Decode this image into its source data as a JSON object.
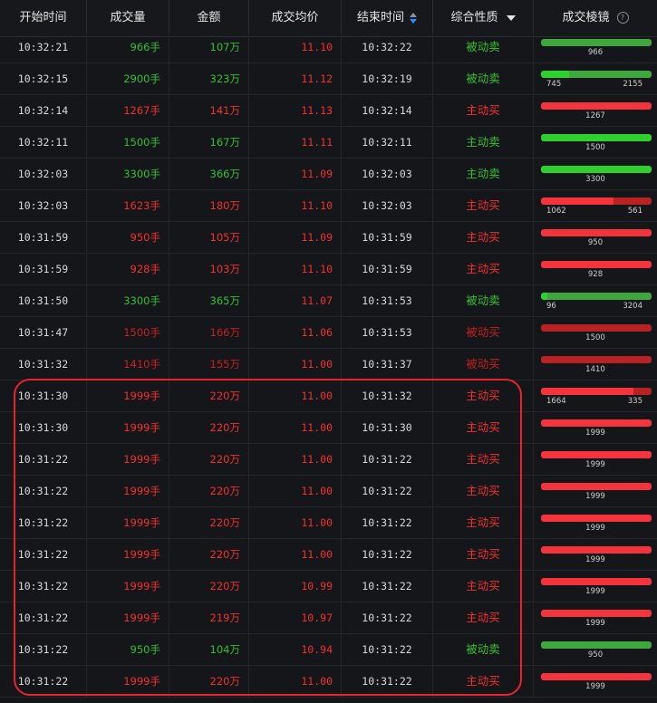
{
  "colors": {
    "buy": "#f23030",
    "sell": "#35c035",
    "dim_buy": "#c42020",
    "bar_buy": "#f5333c",
    "bar_sell": "#3ec83e",
    "highlight": "#e8232f"
  },
  "headers": {
    "start_time": "开始时间",
    "volume": "成交量",
    "amount": "金额",
    "avg_price": "成交均价",
    "end_time": "结束时间",
    "nature": "综合性质",
    "lens": "成交棱镜"
  },
  "icons": {
    "sort": "sort-icon",
    "filter": "filter-caret-icon",
    "help": "question-circle-icon"
  },
  "rows": [
    {
      "start": "10:32:21",
      "vol": "966手",
      "amt": "107万",
      "price": "11.10",
      "end": "10:32:22",
      "nature": "被动卖",
      "vcol": "g",
      "ncol": "g",
      "pcol": "r",
      "bar": [
        {
          "c": "sell",
          "v": 966,
          "label": "966"
        }
      ]
    },
    {
      "start": "10:32:15",
      "vol": "2900手",
      "amt": "323万",
      "price": "11.12",
      "end": "10:32:19",
      "nature": "被动卖",
      "vcol": "g",
      "ncol": "g",
      "pcol": "r",
      "bar": [
        {
          "c": "sell_bright",
          "v": 745,
          "label": "745"
        },
        {
          "c": "sell",
          "v": 2155,
          "label": "2155"
        }
      ]
    },
    {
      "start": "10:32:14",
      "vol": "1267手",
      "amt": "141万",
      "price": "11.13",
      "end": "10:32:14",
      "nature": "主动买",
      "vcol": "r",
      "ncol": "r",
      "pcol": "r",
      "bar": [
        {
          "c": "buy",
          "v": 1267,
          "label": "1267"
        }
      ]
    },
    {
      "start": "10:32:11",
      "vol": "1500手",
      "amt": "167万",
      "price": "11.11",
      "end": "10:32:11",
      "nature": "主动卖",
      "vcol": "g",
      "ncol": "g",
      "pcol": "r",
      "bar": [
        {
          "c": "sell_bright",
          "v": 1500,
          "label": "1500"
        }
      ]
    },
    {
      "start": "10:32:03",
      "vol": "3300手",
      "amt": "366万",
      "price": "11.09",
      "end": "10:32:03",
      "nature": "主动卖",
      "vcol": "g",
      "ncol": "g",
      "pcol": "r",
      "bar": [
        {
          "c": "sell_bright",
          "v": 3300,
          "label": "3300"
        }
      ]
    },
    {
      "start": "10:32:03",
      "vol": "1623手",
      "amt": "180万",
      "price": "11.10",
      "end": "10:32:03",
      "nature": "主动买",
      "vcol": "r",
      "ncol": "r",
      "pcol": "r",
      "bar": [
        {
          "c": "buy",
          "v": 1062,
          "label": "1062"
        },
        {
          "c": "buy_dim",
          "v": 561,
          "label": "561"
        }
      ]
    },
    {
      "start": "10:31:59",
      "vol": "950手",
      "amt": "105万",
      "price": "11.09",
      "end": "10:31:59",
      "nature": "主动买",
      "vcol": "r",
      "ncol": "r",
      "pcol": "r",
      "bar": [
        {
          "c": "buy",
          "v": 950,
          "label": "950"
        }
      ]
    },
    {
      "start": "10:31:59",
      "vol": "928手",
      "amt": "103万",
      "price": "11.10",
      "end": "10:31:59",
      "nature": "主动买",
      "vcol": "r",
      "ncol": "r",
      "pcol": "r",
      "bar": [
        {
          "c": "buy",
          "v": 928,
          "label": "928"
        }
      ]
    },
    {
      "start": "10:31:50",
      "vol": "3300手",
      "amt": "365万",
      "price": "11.07",
      "end": "10:31:53",
      "nature": "被动卖",
      "vcol": "g",
      "ncol": "g",
      "pcol": "r",
      "bar": [
        {
          "c": "sell_bright",
          "v": 96,
          "label": "96"
        },
        {
          "c": "sell",
          "v": 3204,
          "label": "3204"
        }
      ]
    },
    {
      "start": "10:31:47",
      "vol": "1500手",
      "amt": "166万",
      "price": "11.06",
      "end": "10:31:53",
      "nature": "被动买",
      "vcol": "dr",
      "ncol": "dr",
      "pcol": "r",
      "bar": [
        {
          "c": "buy_dim",
          "v": 1500,
          "label": "1500"
        }
      ]
    },
    {
      "start": "10:31:32",
      "vol": "1410手",
      "amt": "155万",
      "price": "11.00",
      "end": "10:31:37",
      "nature": "被动买",
      "vcol": "dr",
      "ncol": "dr",
      "pcol": "r",
      "bar": [
        {
          "c": "buy_dim",
          "v": 1410,
          "label": "1410"
        }
      ]
    },
    {
      "start": "10:31:30",
      "vol": "1999手",
      "amt": "220万",
      "price": "11.00",
      "end": "10:31:32",
      "nature": "主动买",
      "vcol": "r",
      "ncol": "r",
      "pcol": "r",
      "bar": [
        {
          "c": "buy",
          "v": 1664,
          "label": "1664"
        },
        {
          "c": "buy_dim",
          "v": 335,
          "label": "335"
        }
      ]
    },
    {
      "start": "10:31:30",
      "vol": "1999手",
      "amt": "220万",
      "price": "11.00",
      "end": "10:31:30",
      "nature": "主动买",
      "vcol": "r",
      "ncol": "r",
      "pcol": "r",
      "bar": [
        {
          "c": "buy",
          "v": 1999,
          "label": "1999"
        }
      ]
    },
    {
      "start": "10:31:22",
      "vol": "1999手",
      "amt": "220万",
      "price": "11.00",
      "end": "10:31:22",
      "nature": "主动买",
      "vcol": "r",
      "ncol": "r",
      "pcol": "r",
      "bar": [
        {
          "c": "buy",
          "v": 1999,
          "label": "1999"
        }
      ]
    },
    {
      "start": "10:31:22",
      "vol": "1999手",
      "amt": "220万",
      "price": "11.00",
      "end": "10:31:22",
      "nature": "主动买",
      "vcol": "r",
      "ncol": "r",
      "pcol": "r",
      "bar": [
        {
          "c": "buy",
          "v": 1999,
          "label": "1999"
        }
      ]
    },
    {
      "start": "10:31:22",
      "vol": "1999手",
      "amt": "220万",
      "price": "11.00",
      "end": "10:31:22",
      "nature": "主动买",
      "vcol": "r",
      "ncol": "r",
      "pcol": "r",
      "bar": [
        {
          "c": "buy",
          "v": 1999,
          "label": "1999"
        }
      ]
    },
    {
      "start": "10:31:22",
      "vol": "1999手",
      "amt": "220万",
      "price": "11.00",
      "end": "10:31:22",
      "nature": "主动买",
      "vcol": "r",
      "ncol": "r",
      "pcol": "r",
      "bar": [
        {
          "c": "buy",
          "v": 1999,
          "label": "1999"
        }
      ]
    },
    {
      "start": "10:31:22",
      "vol": "1999手",
      "amt": "220万",
      "price": "10.99",
      "end": "10:31:22",
      "nature": "主动买",
      "vcol": "r",
      "ncol": "r",
      "pcol": "r",
      "bar": [
        {
          "c": "buy",
          "v": 1999,
          "label": "1999"
        }
      ]
    },
    {
      "start": "10:31:22",
      "vol": "1999手",
      "amt": "219万",
      "price": "10.97",
      "end": "10:31:22",
      "nature": "主动买",
      "vcol": "r",
      "ncol": "r",
      "pcol": "r",
      "bar": [
        {
          "c": "buy",
          "v": 1999,
          "label": "1999"
        }
      ]
    },
    {
      "start": "10:31:22",
      "vol": "950手",
      "amt": "104万",
      "price": "10.94",
      "end": "10:31:22",
      "nature": "被动卖",
      "vcol": "g",
      "ncol": "g",
      "pcol": "r",
      "bar": [
        {
          "c": "sell",
          "v": 950,
          "label": "950"
        }
      ]
    },
    {
      "start": "10:31:22",
      "vol": "1999手",
      "amt": "220万",
      "price": "11.00",
      "end": "10:31:22",
      "nature": "主动买",
      "vcol": "r",
      "ncol": "r",
      "pcol": "r",
      "bar": [
        {
          "c": "buy",
          "v": 1999,
          "label": "1999"
        }
      ]
    }
  ]
}
